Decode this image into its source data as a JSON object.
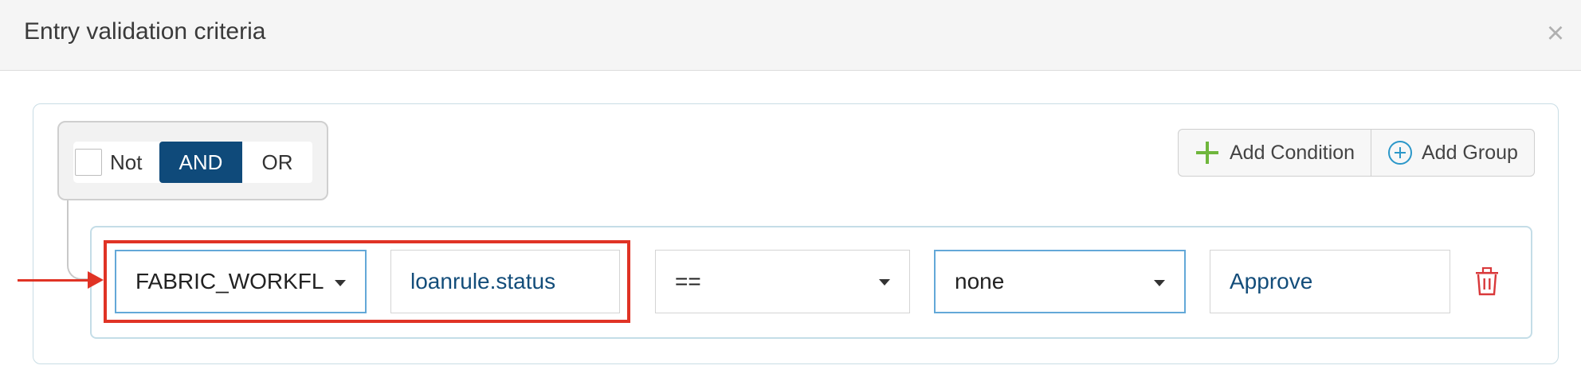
{
  "dialog": {
    "title": "Entry validation criteria",
    "close_glyph": "×"
  },
  "logic": {
    "not_label": "Not",
    "not_checked": false,
    "and_label": "AND",
    "or_label": "OR",
    "selected": "AND"
  },
  "actions": {
    "add_condition": "Add Condition",
    "add_group": "Add Group"
  },
  "condition": {
    "field_value": "FABRIC_WORKFLOW",
    "attribute_value": "loanrule.status",
    "operator_value": "==",
    "modifier_value": "none",
    "value": "Approve"
  },
  "icons": {
    "add_condition": "plus-icon",
    "add_group": "circle-plus-icon",
    "delete": "trash-icon",
    "close": "close-icon",
    "dropdown": "caret-down-icon"
  },
  "colors": {
    "and_active_bg": "#0f4a7a",
    "add_condition_icon": "#6fb63c",
    "add_group_icon": "#2b97c9",
    "delete_icon": "#d9383a",
    "annotation": "#e03325",
    "value_text": "#134d7a"
  }
}
